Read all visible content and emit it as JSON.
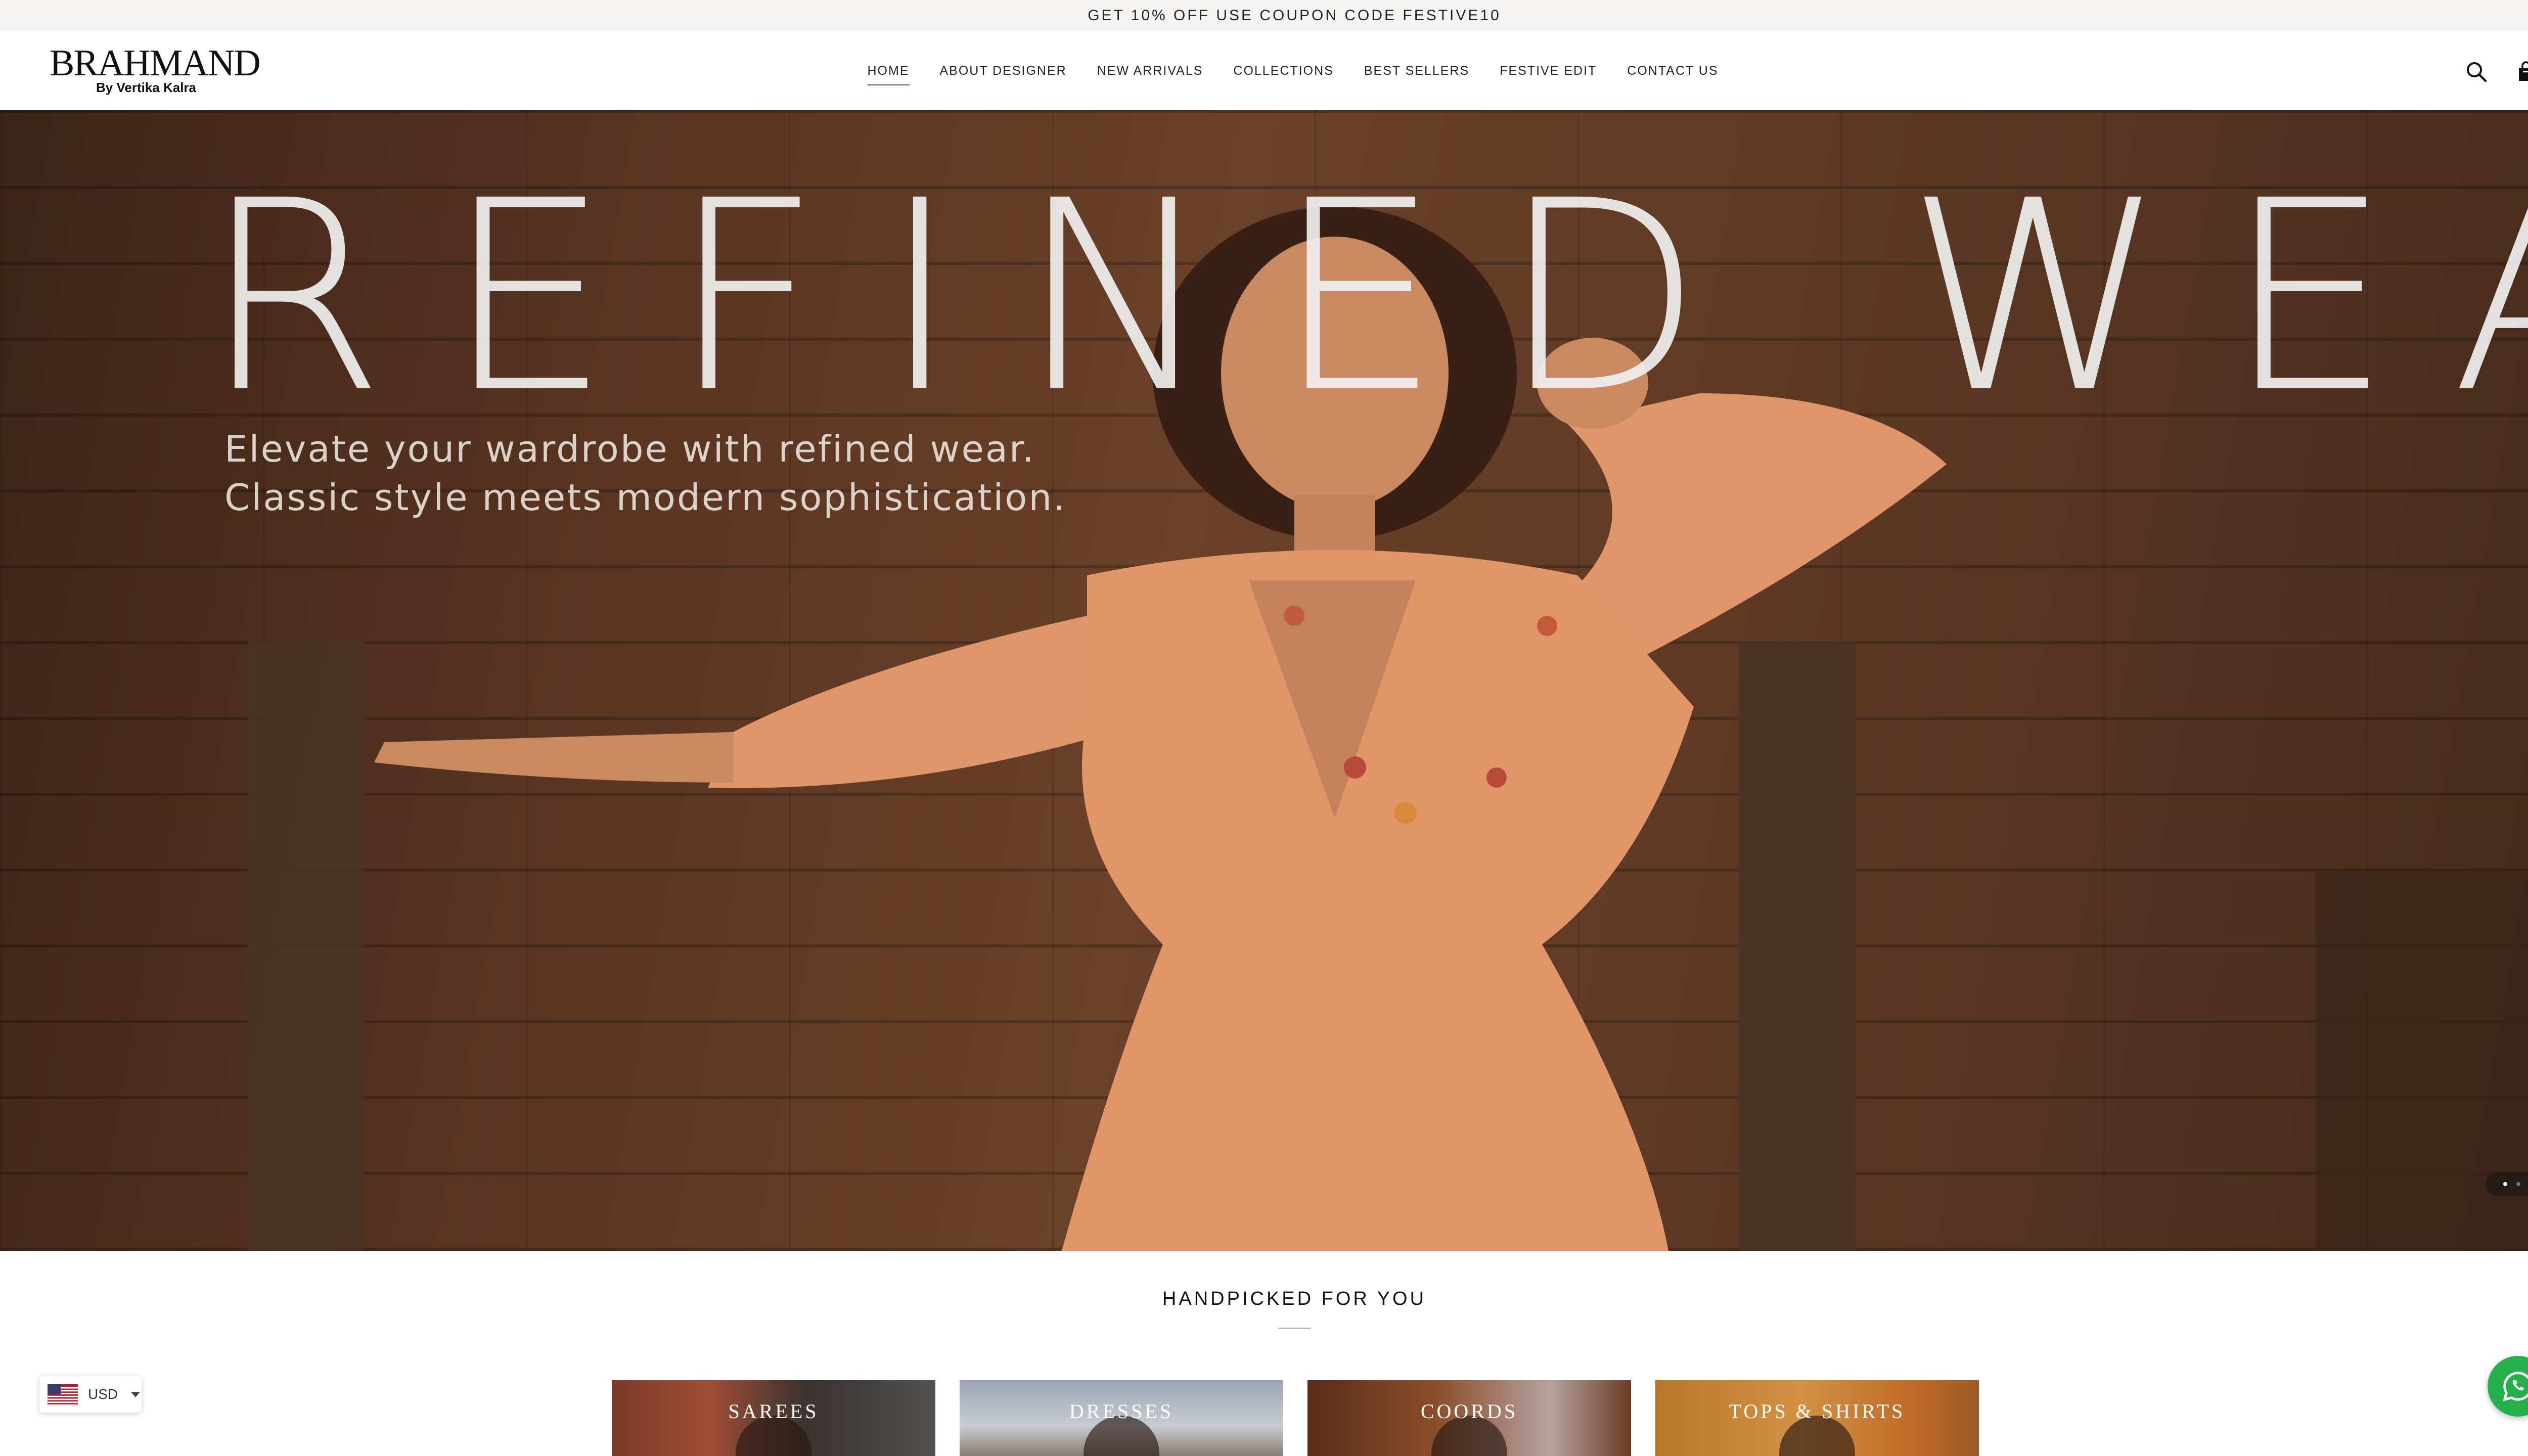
{
  "announcement": "GET 10% OFF USE COUPON CODE FESTIVE10",
  "brand": {
    "name": "BRAHMAND",
    "tagline": "By Vertika Kalra"
  },
  "nav": {
    "items": [
      {
        "label": "HOME",
        "active": true
      },
      {
        "label": "ABOUT DESIGNER"
      },
      {
        "label": "NEW ARRIVALS"
      },
      {
        "label": "COLLECTIONS"
      },
      {
        "label": "BEST SELLERS"
      },
      {
        "label": "FESTIVE EDIT"
      },
      {
        "label": "CONTACT US"
      }
    ]
  },
  "header_icons": [
    "search-icon",
    "shopping-bag-icon"
  ],
  "hero": {
    "title": "REFINED WEAR",
    "subtitle": "Elevate your wardrobe with refined wear.\nClassic style meets modern sophistication.",
    "slide_count": 2,
    "active_slide": 1
  },
  "handpicked": {
    "title": "HANDPICKED FOR YOU",
    "categories": [
      {
        "label": "SAREES"
      },
      {
        "label": "DRESSES"
      },
      {
        "label": "COORDS"
      },
      {
        "label": "TOPS & SHIRTS"
      }
    ]
  },
  "currency": {
    "code": "USD",
    "flag": "us-flag-icon"
  },
  "colors": {
    "announcement_bg": "#f4f3f1",
    "hero_wood": "#5a3522",
    "dress_peach": "#e3956a",
    "whatsapp_green": "#25b04b"
  },
  "floating": {
    "chat_icon": "whatsapp-icon"
  }
}
